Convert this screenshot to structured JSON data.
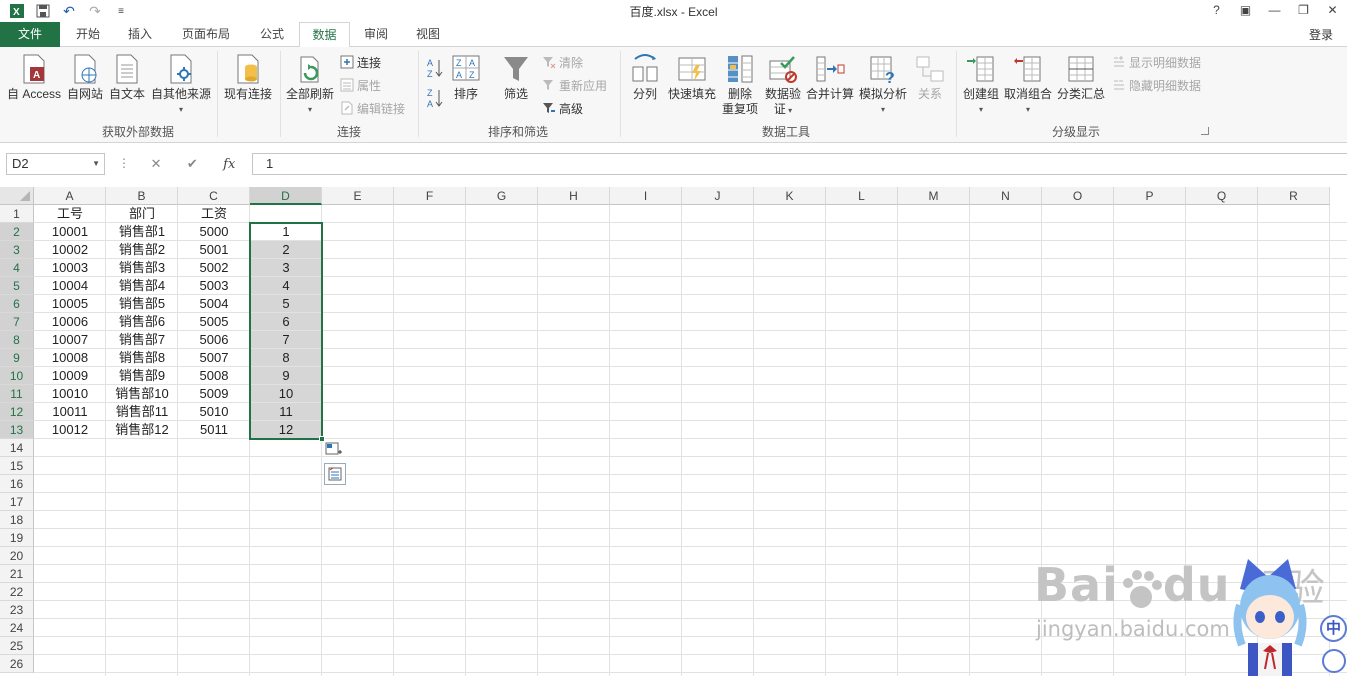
{
  "window": {
    "title": "百度.xlsx - Excel",
    "help": "?",
    "ribbon_display": "▣",
    "minimize": "—",
    "restore": "❐",
    "close": "✕",
    "login": "登录"
  },
  "qat": {
    "undo": "↶",
    "redo": "↷",
    "more": "≡"
  },
  "tabs": [
    "文件",
    "开始",
    "插入",
    "页面布局",
    "公式",
    "数据",
    "审阅",
    "视图"
  ],
  "active_tab": "数据",
  "ribbon": {
    "external": {
      "access": "自 Access",
      "web": "自网站",
      "text": "自文本",
      "other": "自其他来源",
      "existing": "现有连接",
      "label": "获取外部数据"
    },
    "connections": {
      "refresh": "全部刷新",
      "connect": "连接",
      "props": "属性",
      "edit_links": "编辑链接",
      "label": "连接"
    },
    "sort": {
      "sort": "排序",
      "filter": "筛选",
      "clear": "清除",
      "reapply": "重新应用",
      "advanced": "高级",
      "label": "排序和筛选"
    },
    "tools": {
      "split": "分列",
      "flash": "快速填充",
      "remove_dup_1": "删除",
      "remove_dup_2": "重复项",
      "validate_1": "数据验",
      "validate_2": "证",
      "consolidate": "合并计算",
      "whatif": "模拟分析",
      "relations": "关系",
      "label": "数据工具"
    },
    "outline": {
      "group": "创建组",
      "ungroup": "取消组合",
      "subtotal": "分类汇总",
      "show_detail": "显示明细数据",
      "hide_detail": "隐藏明细数据",
      "label": "分级显示"
    }
  },
  "formula_bar": {
    "name_box": "D2",
    "cancel": "✕",
    "enter": "✔",
    "fx": "fx",
    "value": "1"
  },
  "columns": [
    "A",
    "B",
    "C",
    "D",
    "E",
    "F",
    "G",
    "H",
    "I",
    "J",
    "K",
    "L",
    "M",
    "N",
    "O",
    "P",
    "Q",
    "R"
  ],
  "rows": [
    "1",
    "2",
    "3",
    "4",
    "5",
    "6",
    "7",
    "8",
    "9",
    "10",
    "11",
    "12",
    "13",
    "14",
    "15",
    "16",
    "17",
    "18",
    "19",
    "20",
    "21",
    "22",
    "23",
    "24",
    "25",
    "26"
  ],
  "headers": {
    "a": "工号",
    "b": "部门",
    "c": "工资"
  },
  "table": [
    [
      "10001",
      "销售部1",
      "5000",
      "1"
    ],
    [
      "10002",
      "销售部2",
      "5001",
      "2"
    ],
    [
      "10003",
      "销售部3",
      "5002",
      "3"
    ],
    [
      "10004",
      "销售部4",
      "5003",
      "4"
    ],
    [
      "10005",
      "销售部5",
      "5004",
      "5"
    ],
    [
      "10006",
      "销售部6",
      "5005",
      "6"
    ],
    [
      "10007",
      "销售部7",
      "5006",
      "7"
    ],
    [
      "10008",
      "销售部8",
      "5007",
      "8"
    ],
    [
      "10009",
      "销售部9",
      "5008",
      "9"
    ],
    [
      "10010",
      "销售部10",
      "5009",
      "10"
    ],
    [
      "10011",
      "销售部11",
      "5010",
      "11"
    ],
    [
      "10012",
      "销售部12",
      "5011",
      "12"
    ]
  ],
  "watermark": {
    "brand": "Bai",
    "brand2": "du",
    "cn": "经验",
    "url": "jingyan.baidu.com",
    "badge": "中"
  },
  "colors": {
    "accent": "#217346",
    "selection": "#d6d6d6"
  }
}
